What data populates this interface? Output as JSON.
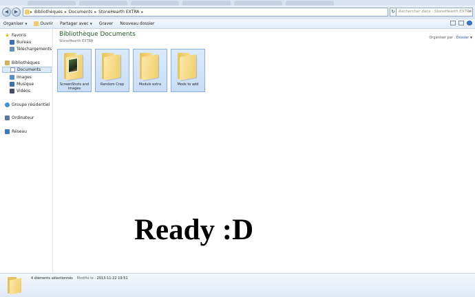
{
  "address": {
    "breadcrumbs": [
      "Bibliothèques",
      "Documents",
      "StoneHearth EXTRA"
    ],
    "search_placeholder": "Rechercher dans : StoneHearth EXTRA"
  },
  "toolbar": {
    "organize": "Organiser",
    "open": "Ouvrir",
    "share": "Partager avec",
    "burn": "Graver",
    "new_folder": "Nouveau dossier"
  },
  "sidebar": {
    "favorites": "Favoris",
    "desktop": "Bureau",
    "downloads": "Téléchargements",
    "libraries": "Bibliothèques",
    "documents": "Documents",
    "images": "Images",
    "music": "Musique",
    "videos": "Vidéos",
    "homegroup": "Groupe résidentiel",
    "computer": "Ordinateur",
    "network": "Réseau"
  },
  "library": {
    "title": "Bibliothèque Documents",
    "subtitle": "StoneHearth EXTRA",
    "arrange_label": "Organiser par :",
    "arrange_value": "Dossier"
  },
  "folders": [
    {
      "name": "ScreenShots and images"
    },
    {
      "name": "Random Crap"
    },
    {
      "name": "Moduls extra"
    },
    {
      "name": "Mods to add"
    }
  ],
  "overlay_text": "Ready :D",
  "status": {
    "selected": "4 éléments sélectionnés",
    "modified_label": "Modifié le :",
    "modified_value": "2013-11-22 19:51"
  },
  "colors": {
    "title_green": "#1e5c1e",
    "selection_blue": "#c8ddf5",
    "folder_yellow": "#f0cd6a"
  }
}
